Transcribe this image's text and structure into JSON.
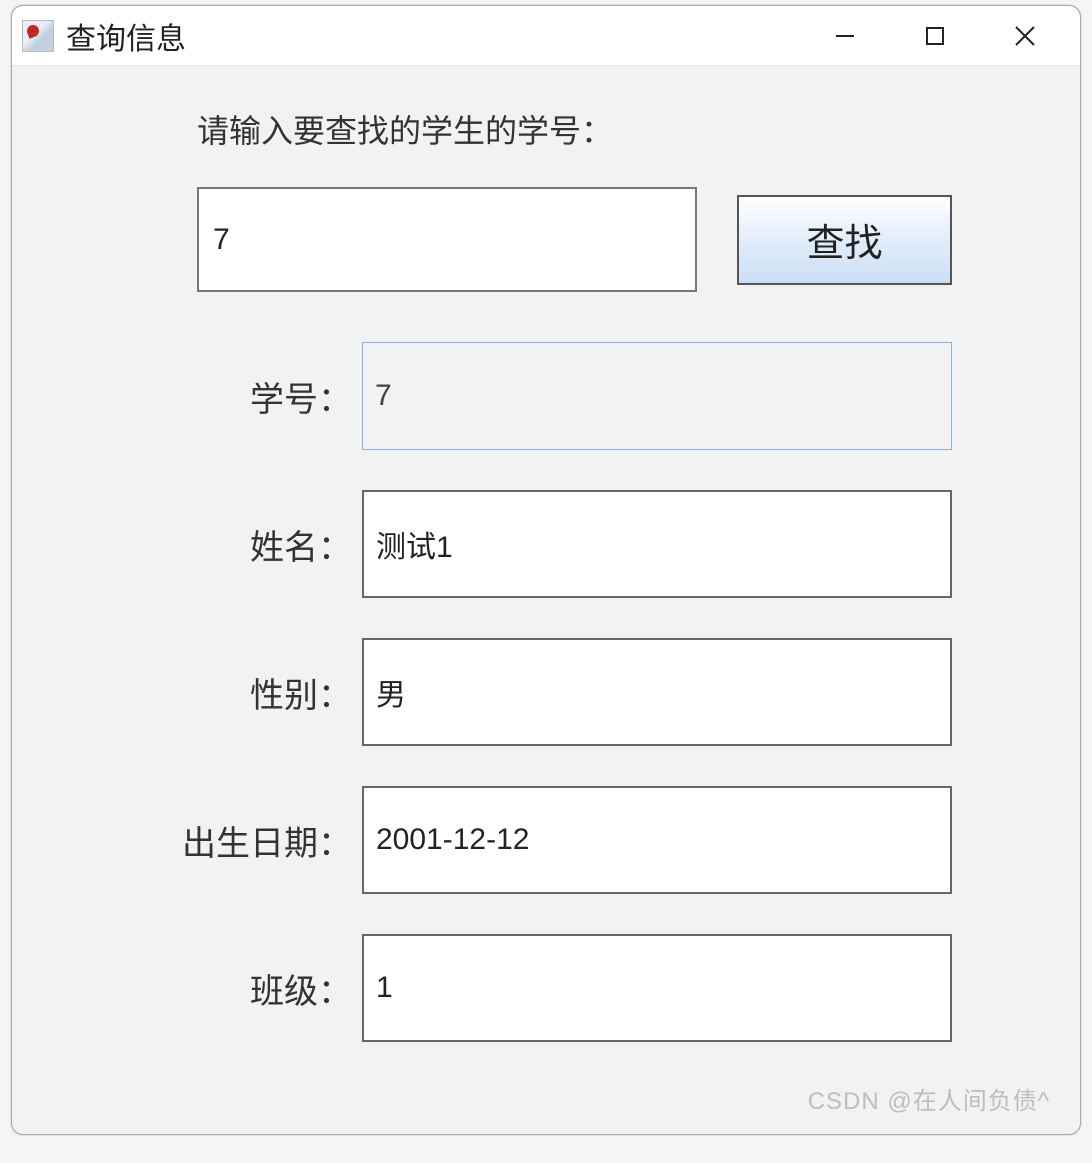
{
  "window": {
    "title": "查询信息"
  },
  "prompt": "请输入要查找的学生的学号：",
  "search": {
    "value": "7",
    "button_label": "查找"
  },
  "fields": [
    {
      "label": "学号：",
      "value": "7",
      "readonly": true
    },
    {
      "label": "姓名：",
      "value": "测试1",
      "readonly": false
    },
    {
      "label": "性别：",
      "value": "男",
      "readonly": false
    },
    {
      "label": "出生日期：",
      "value": "2001-12-12",
      "readonly": false
    },
    {
      "label": "班级：",
      "value": "1",
      "readonly": false
    }
  ],
  "watermark": "CSDN @在人间负债^"
}
